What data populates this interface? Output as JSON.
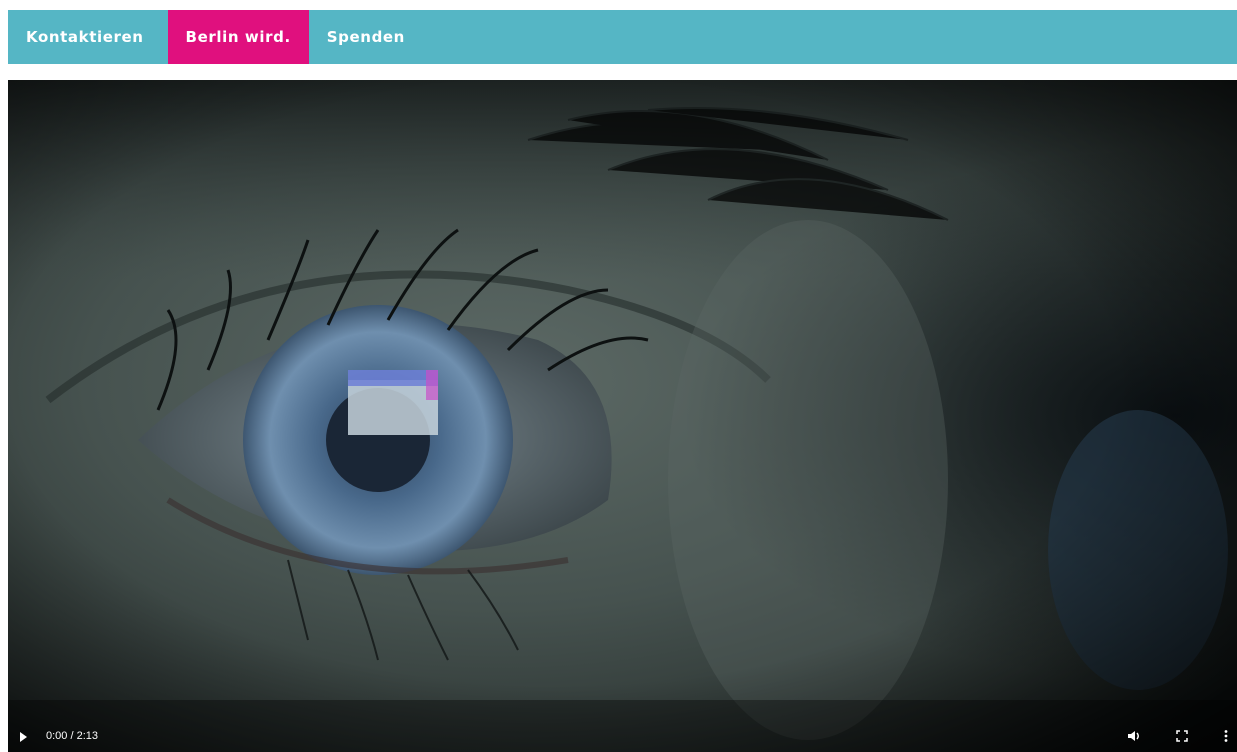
{
  "nav": {
    "items": [
      {
        "label": "Kontaktieren",
        "active": false
      },
      {
        "label": "Berlin wird.",
        "active": true
      },
      {
        "label": "Spenden",
        "active": false
      }
    ],
    "bar_color": "#55b6c5",
    "active_color": "#e0107e"
  },
  "video": {
    "time_display": "0:00 / 2:13",
    "icons": {
      "play": "play-icon",
      "volume": "volume-icon",
      "fullscreen": "fullscreen-icon",
      "more": "more-options-icon"
    }
  }
}
